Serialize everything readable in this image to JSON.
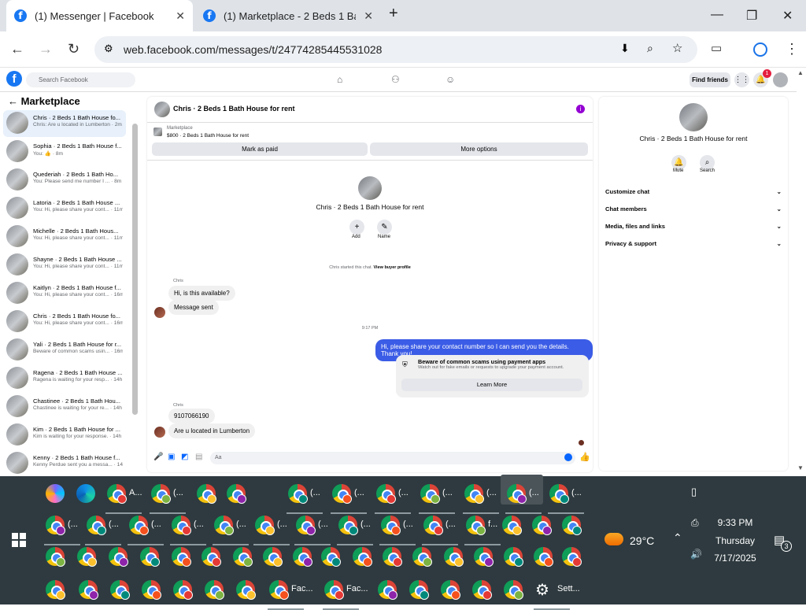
{
  "browser": {
    "tabs": [
      {
        "title": "(1) Messenger | Facebook"
      },
      {
        "title": "(1) Marketplace - 2 Beds 1 Bath"
      }
    ],
    "url": "web.facebook.com/messages/t/24774285445531028"
  },
  "fb": {
    "search_placeholder": "Search Facebook",
    "find_friends": "Find friends",
    "notif_count": "1"
  },
  "sidebar": {
    "title": "Marketplace",
    "items": [
      {
        "name": "Chris · 2 Beds 1 Bath House fo...",
        "preview": "Chris: Are u located in Lumberton · 2m"
      },
      {
        "name": "Sophia · 2 Beds 1 Bath House f...",
        "preview": "You: 👍 · 8m"
      },
      {
        "name": "Quederiah · 2 Beds 1 Bath Ho...",
        "preview": "You: Please send me number I ... · 8m"
      },
      {
        "name": "Latoria · 2 Beds 1 Bath House ...",
        "preview": "You: Hi, please share your cont... · 11m"
      },
      {
        "name": "Michelle · 2 Beds 1 Bath Hous...",
        "preview": "You: Hi, please share your cont... · 11m"
      },
      {
        "name": "Shayne · 2 Beds 1 Bath House ...",
        "preview": "You: Hi, please share your cont... · 11m"
      },
      {
        "name": "Kaitlyn · 2 Beds 1 Bath House f...",
        "preview": "You: Hi, please share your cont... · 16m"
      },
      {
        "name": "Chris · 2 Beds 1 Bath House fo...",
        "preview": "You: Hi, please share your cont... · 16m"
      },
      {
        "name": "Yali · 2 Beds 1 Bath House for r...",
        "preview": "Beware of common scams usin... · 16m"
      },
      {
        "name": "Ragena · 2 Beds 1 Bath House ...",
        "preview": "Ragena is waiting for your resp... · 14h"
      },
      {
        "name": "Chastinee · 2 Beds 1 Bath Hou...",
        "preview": "Chastinee is waiting for your re... · 14h"
      },
      {
        "name": "Kim · 2 Beds 1 Bath House for ...",
        "preview": "Kim is waiting for your response. · 14h"
      },
      {
        "name": "Kenny · 2 Beds 1 Bath House f...",
        "preview": "Kenny Perdue sent you a messa... · 14h"
      }
    ]
  },
  "chat": {
    "header_title": "Chris · 2 Beds 1 Bath House for rent",
    "listing_source": "Marketplace",
    "listing_info": "$800 · 2 Beds 1 Bath House for rent",
    "mark_paid": "Mark as paid",
    "more_options": "More options",
    "profile_name": "Chris · 2 Beds 1 Bath House for rent",
    "add_label": "Add",
    "name_label": "Name",
    "started_text": "Chris started this chat.",
    "view_buyer": "View buyer profile",
    "sender1": "Chris",
    "msg1": "Hi, is this available?",
    "msg2": "Message sent",
    "time1": "9:17 PM",
    "out_msg": "Hi, please share your contact number so I can send you the details. Thank you!",
    "scam_title": "Beware of common scams using payment apps",
    "scam_body": "Watch out for fake emails or requests to upgrade your payment account.",
    "learn_more": "Learn More",
    "sender2": "Chris",
    "msg3": "9107066190",
    "msg4": "Are u located in Lumberton",
    "input_placeholder": "Aa"
  },
  "panel": {
    "name": "Chris · 2 Beds 1 Bath House for rent",
    "mute": "Mute",
    "search": "Search",
    "sections": [
      "Customize chat",
      "Chat members",
      "Media, files and links",
      "Privacy & support"
    ]
  },
  "taskbar": {
    "row1_labels": [
      "A...",
      "(...",
      "(...",
      "(...",
      "(...",
      "(...",
      "(...",
      "(...",
      "(..."
    ],
    "row2_labels": [
      "(...",
      "(...",
      "(...",
      "(...",
      "(...",
      "(...",
      "(...",
      "(...",
      "(...",
      "(...",
      "f..."
    ],
    "row4_labels": [
      "Fac...",
      "Fac...",
      "Sett..."
    ],
    "weather": "29°C",
    "time": "9:33 PM",
    "day": "Thursday",
    "date": "7/17/2025",
    "notif_count": "3"
  }
}
